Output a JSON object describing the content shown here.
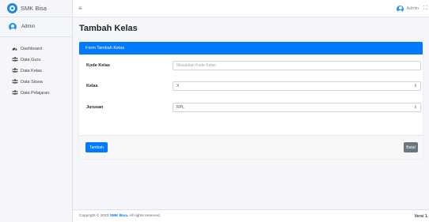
{
  "brand": {
    "name": "SMK Bisa"
  },
  "sidebar": {
    "user": "Admin",
    "items": [
      {
        "label": "Dashboard",
        "icon": "dashboard-icon"
      },
      {
        "label": "Data Guru",
        "icon": "users-icon"
      },
      {
        "label": "Data Kelas",
        "icon": "users-icon"
      },
      {
        "label": "Data Siswa",
        "icon": "users-icon"
      },
      {
        "label": "Data Pelajaran",
        "icon": "users-icon"
      }
    ]
  },
  "topbar": {
    "user": "Admin",
    "menu_icon": "hamburger-icon",
    "expand_icon": "expand-icon"
  },
  "page": {
    "title": "Tambah Kelas"
  },
  "form": {
    "header": "Form Tambah Kelas",
    "fields": {
      "kode_kelas": {
        "label": "Kode Kelas",
        "placeholder": "Masukkan Kode Kelas",
        "value": ""
      },
      "kelas": {
        "label": "Kelas",
        "value": "X"
      },
      "jurusan": {
        "label": "Jurusan",
        "value": "RPL"
      }
    },
    "submit_label": "Tambah",
    "cancel_label": "Batal"
  },
  "footer": {
    "prefix": "Copyright © 2023 ",
    "brand": "SMK Bisa.",
    "suffix": " All rights reserved.",
    "version": "Versi 1."
  },
  "colors": {
    "primary": "#007bff",
    "secondary": "#6c757d",
    "sidebar_bg": "#f4f6f9"
  }
}
